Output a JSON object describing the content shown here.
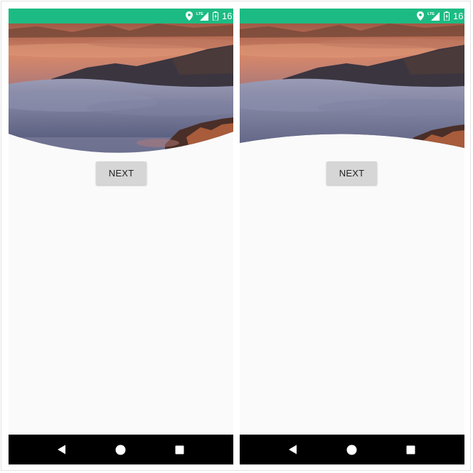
{
  "screens": [
    {
      "id": "left",
      "status_bar": {
        "time": "16:",
        "network": "LTE"
      },
      "header": {
        "shape": "convex-bottom curve",
        "image": "mountain sunset over sea of clouds"
      },
      "button": {
        "label": "NEXT"
      },
      "nav_bar": {
        "back": "back-icon",
        "home": "home-icon",
        "recents": "recents-icon"
      }
    },
    {
      "id": "right",
      "status_bar": {
        "time": "16:",
        "network": "LTE"
      },
      "header": {
        "shape": "concave-bottom curve",
        "image": "mountain sunset over sea of clouds"
      },
      "button": {
        "label": "NEXT"
      },
      "nav_bar": {
        "back": "back-icon",
        "home": "home-icon",
        "recents": "recents-icon"
      }
    }
  ],
  "colors": {
    "status_bar": "#1dbb84",
    "background": "#fafafa",
    "button": "#d6d6d6",
    "nav_bar": "#000000"
  }
}
